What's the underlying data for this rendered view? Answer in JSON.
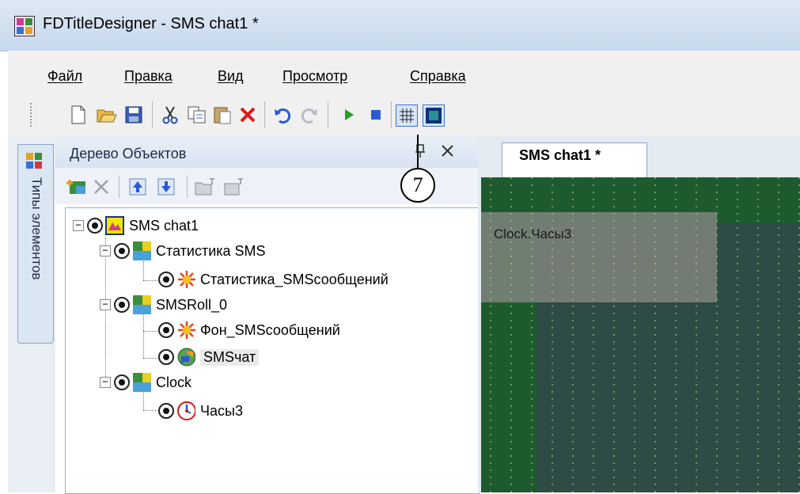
{
  "window": {
    "title": "FDTitleDesigner - SMS chat1 *"
  },
  "menu": [
    "Файл",
    "Правка",
    "Вид",
    "Просмотр",
    "Справка"
  ],
  "toolbar": {
    "icons": [
      "new-file-icon",
      "open-folder-icon",
      "save-icon",
      "cut-icon",
      "copy-icon",
      "paste-icon",
      "delete-icon",
      "undo-icon",
      "redo-icon",
      "play-icon",
      "stop-icon",
      "grid-icon",
      "safe-area-icon"
    ],
    "colors": {
      "play": "#2b9a2b",
      "stop": "#2a5ad2",
      "delete": "#e01818"
    }
  },
  "side_tab": {
    "label": "Типы элементов"
  },
  "panel": {
    "title": "Дерево Объектов",
    "toolbar_icons": [
      "add-object-icon",
      "delete-object-icon",
      "move-up-icon",
      "move-down-icon",
      "import-icon",
      "export-icon"
    ]
  },
  "tree": [
    {
      "label": "SMS chat1",
      "icon": "project-icon",
      "level": 0
    },
    {
      "label": "Статистика SMS",
      "icon": "layer-icon",
      "level": 1
    },
    {
      "label": "Статистика_SMSсообщений",
      "icon": "effect-icon",
      "level": 2
    },
    {
      "label": "SMSRoll_0",
      "icon": "layer-icon",
      "level": 1
    },
    {
      "label": "Фон_SMSсообщений",
      "icon": "effect-icon",
      "level": 2
    },
    {
      "label": "SMSчат",
      "icon": "chat-icon",
      "level": 2,
      "selected": true
    },
    {
      "label": "Clock",
      "icon": "layer-icon",
      "level": 1
    },
    {
      "label": "Часы3",
      "icon": "clock-icon",
      "level": 2
    }
  ],
  "document": {
    "tab_label": "SMS chat1 *",
    "canvas_label": "Clock.Часы3",
    "colors": {
      "canvas": "#2e4b45",
      "band": "#1d5b2e",
      "grid": "#c8d48c"
    }
  },
  "callout": {
    "number": "7"
  }
}
